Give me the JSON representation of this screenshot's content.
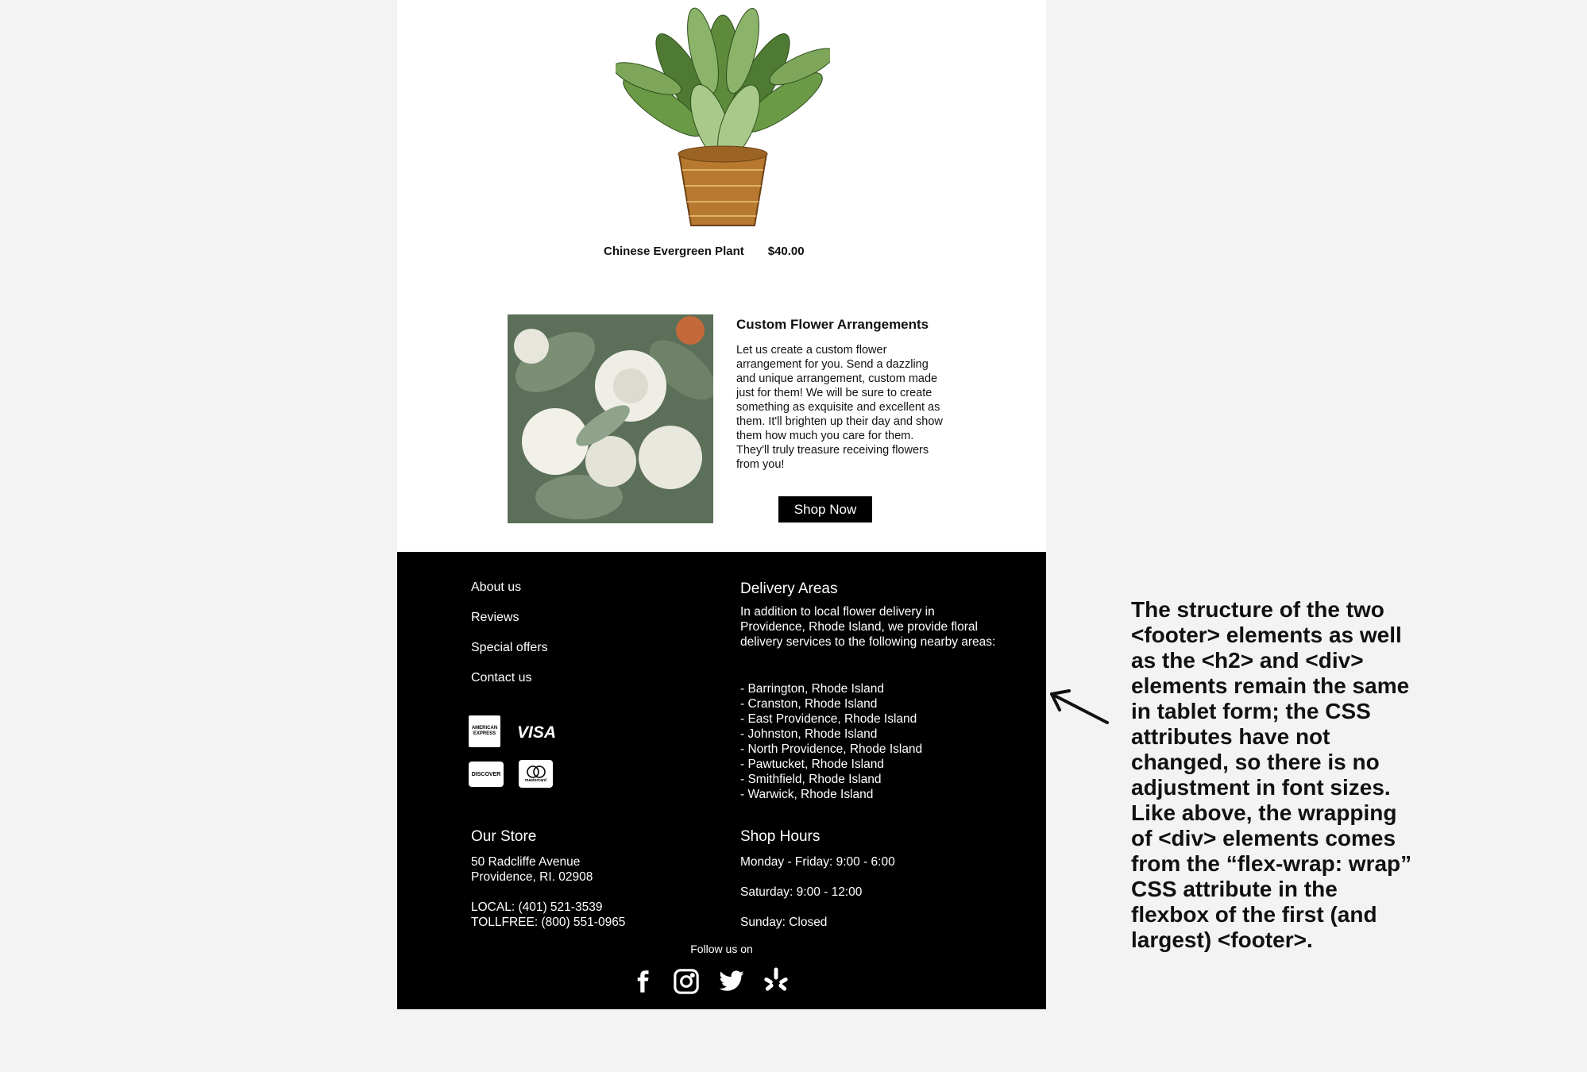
{
  "product": {
    "name": "Chinese Evergreen Plant",
    "price": "$40.00"
  },
  "custom": {
    "title": "Custom Flower Arrangements",
    "body": "Let us create a custom flower arrangement for you.  Send a dazzling and unique arrangement, custom made just for them! We will be sure to create something as exquisite and excellent as them. It'll brighten up their day and show them how much you care for them. They'll truly treasure receiving flowers from you!",
    "button": "Shop Now"
  },
  "footer": {
    "nav": [
      "About us",
      "Reviews",
      "Special offers",
      "Contact us"
    ],
    "cards": {
      "amex": "AMERICAN EXPRESS",
      "visa": "VISA",
      "discover": "DISCOVER",
      "mastercard": "mastercard"
    },
    "delivery": {
      "title": "Delivery Areas",
      "intro": "In addition to local flower delivery in Providence, Rhode Island, we provide floral delivery services to the following nearby areas:",
      "areas": [
        "- Barrington, Rhode Island",
        "- Cranston, Rhode Island",
        "- East Providence, Rhode Island",
        "- Johnston, Rhode Island",
        "- North Providence, Rhode Island",
        "- Pawtucket, Rhode Island",
        "- Smithfield, Rhode Island",
        "- Warwick, Rhode Island"
      ]
    },
    "store": {
      "title": "Our Store",
      "address1": "50 Radcliffe Avenue",
      "address2": "Providence, RI. 02908",
      "local": "LOCAL: (401) 521-3539",
      "tollfree": "TOLLFREE: (800) 551-0965"
    },
    "hours": {
      "title": "Shop Hours",
      "weekday": "Monday - Friday: 9:00 - 6:00",
      "saturday": "Saturday: 9:00 - 12:00",
      "sunday": "Sunday: Closed"
    },
    "follow": "Follow us on",
    "social_icons": [
      "facebook-icon",
      "instagram-icon",
      "twitter-icon",
      "yelp-icon"
    ]
  },
  "annotation": {
    "text": "The structure of the two <footer> elements as well as the <h2> and <div> elements remain the same in tablet form; the CSS attributes have not changed, so there is no adjustment in font sizes. Like above, the wrapping of <div> elements comes from the “flex-wrap: wrap” CSS attribute in the flexbox of the first (and largest) <footer>."
  }
}
